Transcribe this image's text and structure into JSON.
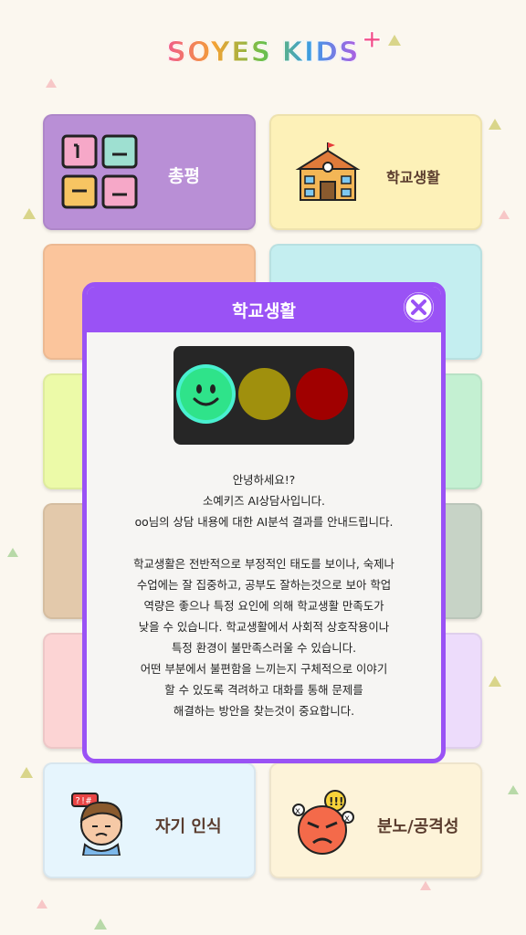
{
  "logo": {
    "text": "SOYES KIDS",
    "plus": "+"
  },
  "cards": [
    {
      "name": "card-overall",
      "label": "총평",
      "bg": "#b98fd6",
      "icon": "chat-bubbles-icon"
    },
    {
      "name": "card-school-life",
      "label": "학교생활",
      "bg": "#fdf1b8",
      "icon": "school-building-icon"
    },
    {
      "name": "card-self-awareness",
      "label": "자기 인식",
      "bg": "#e6f5fd",
      "icon": "confused-boy-icon"
    },
    {
      "name": "card-anger",
      "label": "분노/공격성",
      "bg": "#fdf3d9",
      "icon": "angry-face-icon"
    }
  ],
  "modal": {
    "title": "학교생활",
    "close_icon": "close-icon",
    "traffic_light": {
      "green": "#2fe38a",
      "yellow": "#a0900d",
      "red": "#a00000",
      "active": "green"
    },
    "greeting": [
      "안녕하세요!?",
      "소예키즈 AI상담사입니다.",
      "oo님의 상담 내용에 대한 AI분석 결과를 안내드립니다."
    ],
    "body": [
      "학교생활은 전반적으로 부정적인 태도를 보이나, 숙제나",
      "수업에는 잘 집중하고, 공부도 잘하는것으로 보아 학업",
      "역량은 좋으나 특정 요인에 의해 학교생활 만족도가",
      "낮을 수 있습니다. 학교생활에서 사회적 상호작용이나",
      "특정 환경이 불만족스러울 수 있습니다.",
      "어떤 부분에서 불편함을 느끼는지 구체적으로 이야기",
      "할 수 있도록 격려하고 대화를 통해 문제를",
      "해결하는 방안을 찾는것이 중요합니다."
    ]
  }
}
